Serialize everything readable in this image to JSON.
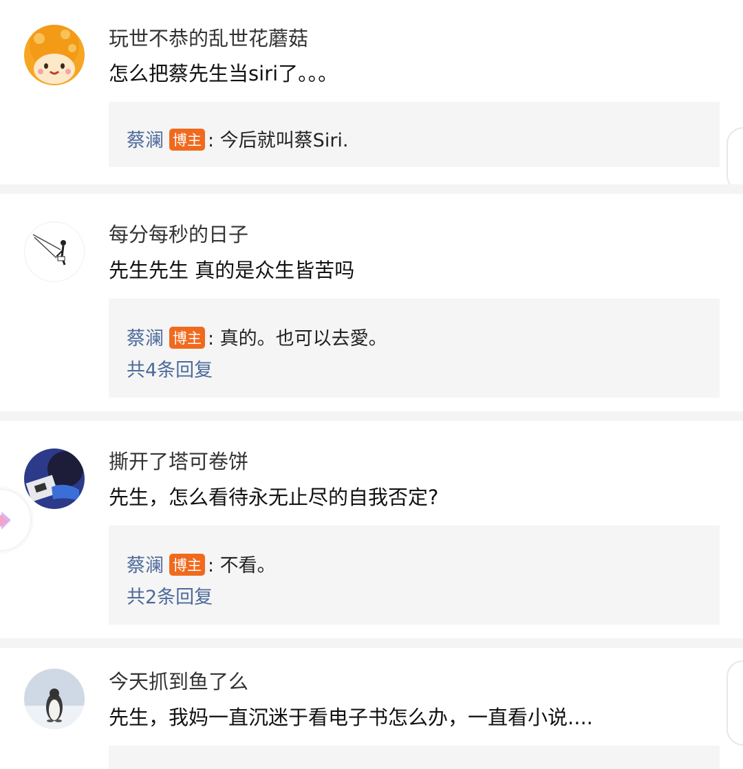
{
  "comments": [
    {
      "username": "玩世不恭的乱世花蘑菇",
      "text": "怎么把蔡先生当siri了。。。",
      "avatar_icon": "orange-mushroom-avatar",
      "reply": {
        "author": "蔡澜",
        "badge": "博主",
        "text": ": 今后就叫蔡Siri."
      }
    },
    {
      "username": "每分每秒的日子",
      "text": "先生先生 真的是众生皆苦吗",
      "avatar_icon": "swing-figure-avatar",
      "reply": {
        "author": "蔡澜",
        "badge": "博主",
        "text": ": 真的。也可以去愛。"
      },
      "more": "共4条回复"
    },
    {
      "username": "撕开了塔可卷饼",
      "text": "先生，怎么看待永无止尽的自我否定?",
      "avatar_icon": "dark-photo-avatar",
      "reply": {
        "author": "蔡澜",
        "badge": "博主",
        "text": ": 不看。"
      },
      "more": "共2条回复"
    },
    {
      "username": "今天抓到鱼了么",
      "text": "先生，我妈一直沉迷于看电子书怎么办，一直看小说....",
      "avatar_icon": "penguin-avatar"
    }
  ],
  "colors": {
    "link": "#4d6a9a",
    "badge": "#f06a1e",
    "reply_bg": "#f5f5f5"
  }
}
